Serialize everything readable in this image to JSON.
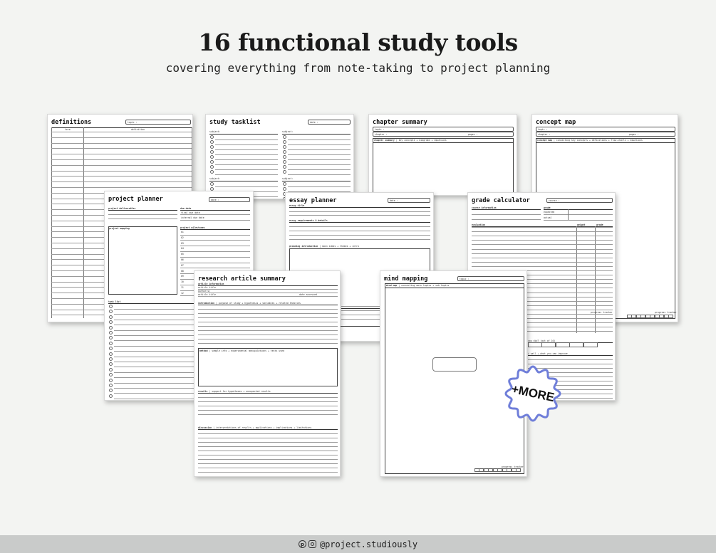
{
  "header": {
    "title": "16 functional study tools",
    "subtitle": "covering everything from note-taking to project planning"
  },
  "sheets": {
    "definitions": {
      "title": "definitions",
      "topic": "topic :",
      "col_term": "term",
      "col_definition": "definition"
    },
    "study_tasklist": {
      "title": "study tasklist",
      "date": "date :",
      "subject": "subject:"
    },
    "chapter_summary": {
      "title": "chapter summary",
      "topic": "topic :",
      "chapter": "chapter :",
      "pages": "pages :",
      "section": "chapter summary",
      "section_hint": "key concepts + diagrams + equations"
    },
    "concept_map": {
      "title": "concept map",
      "topic": "topic :",
      "chapter": "chapter :",
      "pages": "pages :",
      "section": "concept map",
      "section_hint": "connecting key concepts + definitions + flow-charts + equations",
      "tracker": "progress tracker"
    },
    "project_planner": {
      "title": "project planner",
      "date": "date :",
      "project_deliverables": "project deliverables",
      "due_date": "due date",
      "final_due": "final due date",
      "internal_due": "internal due date",
      "project_mapping": "project mapping",
      "milestones": "project milestones",
      "milestone_numbers": [
        "01",
        "02",
        "03",
        "04",
        "05",
        "06",
        "07",
        "08",
        "09",
        "10",
        "11",
        "12"
      ],
      "task_list": "task list"
    },
    "essay_planner": {
      "title": "essay planner",
      "date": "date :",
      "essay_title": "essay title",
      "requirements": "essay requirements & details",
      "planning": "planning introduction",
      "planning_hint": "main ideas + themes + intro"
    },
    "grade_calculator": {
      "title": "grade calculator",
      "course": "course :",
      "course_info": "course information",
      "grade": "grade",
      "expected": "expected",
      "actual": "actual",
      "evaluation": "evaluation",
      "weight": "weight",
      "grade_col": "grade",
      "tracker": "progress tracker",
      "did": "you did? (out of 10)",
      "well": "i well + what you can improve"
    },
    "research_article_summary": {
      "title": "research article summary",
      "article_info": "article information",
      "article_title": "article title",
      "authors": "author(s)",
      "article_title2": "article title",
      "date_accessed": "date accessed",
      "introduction": "introduction",
      "introduction_hint": "purpose of study + hypothesis + variables + related theories",
      "method": "method",
      "method_hint": "sample info + experimental manipulations + tests used",
      "results": "results",
      "results_hint": "support for hypotheses + unexpected results",
      "discussion": "discussion",
      "discussion_hint": "interpretations of results + applications + implications + limitations"
    },
    "mind_mapping": {
      "title": "mind mapping",
      "topic": "topic :",
      "section": "mind map",
      "section_hint": "connecting main topics + sub topics",
      "tracker": "progress tracker"
    }
  },
  "badge": {
    "label": "+MORE",
    "color": "#6f7ed9"
  },
  "footer": {
    "pinterest_icon": "pinterest-icon",
    "instagram_icon": "instagram-icon",
    "handle": "@project.studiously"
  }
}
